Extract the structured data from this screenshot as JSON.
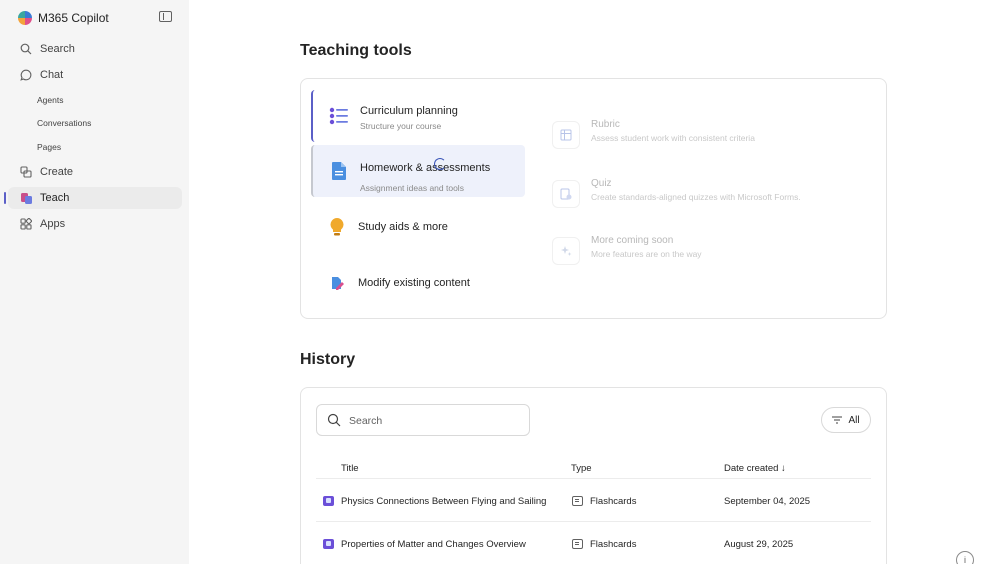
{
  "app": {
    "title": "M365 Copilot"
  },
  "sidebar": {
    "items": [
      {
        "label": "Search",
        "icon": "search-icon"
      },
      {
        "label": "Chat",
        "icon": "chat-icon"
      },
      {
        "label": "Agents"
      },
      {
        "label": "Conversations"
      },
      {
        "label": "Pages"
      },
      {
        "label": "Create",
        "icon": "create-icon"
      },
      {
        "label": "Teach",
        "icon": "teach-icon",
        "active": true
      },
      {
        "label": "Apps",
        "icon": "apps-icon"
      }
    ]
  },
  "teaching_tools": {
    "heading": "Teaching tools",
    "tools": [
      {
        "title": "Curriculum planning",
        "subtitle": "Structure your course",
        "icon": "list-icon",
        "selected": true
      },
      {
        "title": "Homework & assessments",
        "subtitle": "Assignment ideas and tools",
        "icon": "document-icon"
      },
      {
        "title": "Study aids & more",
        "subtitle": "",
        "icon": "lightbulb-icon"
      },
      {
        "title": "Modify existing content",
        "subtitle": "",
        "icon": "edit-document-icon"
      }
    ],
    "options": [
      {
        "title": "Rubric",
        "subtitle": "Assess student work with consistent criteria",
        "icon": "table-icon"
      },
      {
        "title": "Quiz",
        "subtitle": "Create standards-aligned quizzes with Microsoft Forms.",
        "icon": "quiz-icon"
      },
      {
        "title": "More coming soon",
        "subtitle": "More features are on the way",
        "icon": "sparkle-icon"
      }
    ]
  },
  "history": {
    "heading": "History",
    "search": {
      "placeholder": "Search"
    },
    "filter_label": "All",
    "columns": {
      "title": "Title",
      "type": "Type",
      "date": "Date created ↓"
    },
    "rows": [
      {
        "title": "Physics Connections Between Flying and Sailing",
        "type": "Flashcards",
        "date": "September 04, 2025"
      },
      {
        "title": "Properties of Matter and Changes Overview",
        "type": "Flashcards",
        "date": "August 29, 2025"
      }
    ]
  },
  "colors": {
    "accent": "#5b5fc7",
    "sidebar_bg": "#f5f5f5"
  }
}
